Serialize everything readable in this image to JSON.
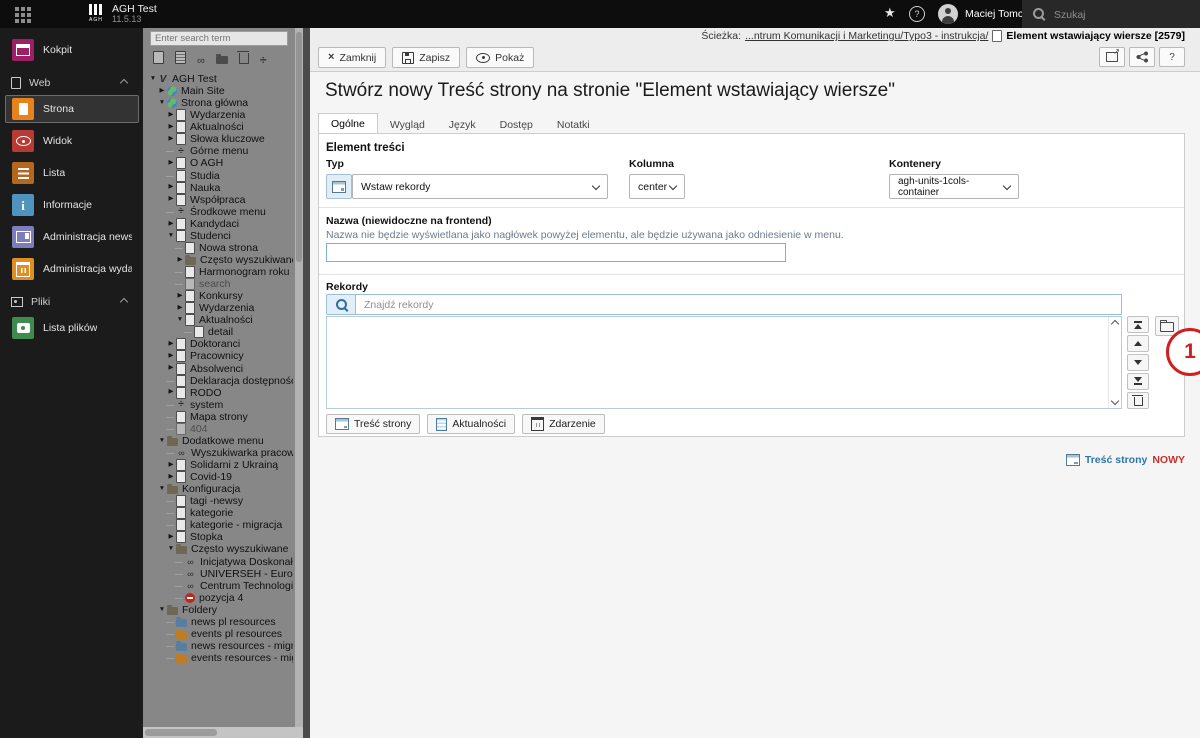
{
  "topbar": {
    "app_title": "AGH Test",
    "version": "11.5.13",
    "user_name": "Maciej Tomczyk",
    "search_placeholder": "Szukaj"
  },
  "sidebar": {
    "entries": [
      {
        "type": "module",
        "label": "Kokpit",
        "icon": "dashboard",
        "color": "#9d2064",
        "active": false
      },
      {
        "type": "header",
        "label": "Web",
        "icon": "page"
      },
      {
        "type": "module",
        "label": "Strona",
        "icon": "page",
        "color": "#e8821d",
        "active": true
      },
      {
        "type": "module",
        "label": "Widok",
        "icon": "eye",
        "color": "#b73b34",
        "active": false
      },
      {
        "type": "module",
        "label": "Lista",
        "icon": "list",
        "color": "#b4671e",
        "active": false
      },
      {
        "type": "module",
        "label": "Informacje",
        "icon": "info",
        "color": "#4f94bd",
        "active": false
      },
      {
        "type": "module",
        "label": "Administracja newsów",
        "icon": "news",
        "color": "#7d7dbb",
        "active": false
      },
      {
        "type": "module",
        "label": "Administracja wydarzeń",
        "icon": "calendar",
        "color": "#df8e22",
        "active": false
      },
      {
        "type": "header",
        "label": "Pliki",
        "icon": "image"
      },
      {
        "type": "module",
        "label": "Lista plików",
        "icon": "media",
        "color": "#3f8b4f",
        "active": false
      }
    ]
  },
  "pagetree": {
    "search_placeholder": "Enter search term",
    "toolbar": [
      {
        "name": "new-page-button",
        "glyph": "page"
      },
      {
        "name": "new-content-page-button",
        "glyph": "page2"
      },
      {
        "name": "new-link-button",
        "glyph": "link"
      },
      {
        "name": "new-folder-button",
        "glyph": "folder"
      },
      {
        "name": "trash-button",
        "glyph": "trash"
      },
      {
        "name": "new-spacer-button",
        "glyph": "spacer"
      }
    ],
    "items": [
      {
        "label": "AGH Test",
        "level": 0,
        "state": "open",
        "icon": "site"
      },
      {
        "label": "Main Site",
        "level": 1,
        "state": "closed",
        "icon": "globe"
      },
      {
        "label": "Strona główna",
        "level": 1,
        "state": "open",
        "icon": "globe"
      },
      {
        "label": "Wydarzenia",
        "level": 2,
        "state": "closed",
        "icon": "page"
      },
      {
        "label": "Aktualności",
        "level": 2,
        "state": "closed",
        "icon": "page"
      },
      {
        "label": "Słowa kluczowe",
        "level": 2,
        "state": "closed",
        "icon": "page"
      },
      {
        "label": "Górne menu",
        "level": 2,
        "state": null,
        "icon": "spacer"
      },
      {
        "label": "O AGH",
        "level": 2,
        "state": "closed",
        "icon": "page"
      },
      {
        "label": "Studia",
        "level": 2,
        "state": null,
        "icon": "page"
      },
      {
        "label": "Nauka",
        "level": 2,
        "state": "closed",
        "icon": "page"
      },
      {
        "label": "Współpraca",
        "level": 2,
        "state": "closed",
        "icon": "page"
      },
      {
        "label": "Środkowe menu",
        "level": 2,
        "state": null,
        "icon": "spacer"
      },
      {
        "label": "Kandydaci",
        "level": 2,
        "state": "closed",
        "icon": "page"
      },
      {
        "label": "Studenci",
        "level": 2,
        "state": "open",
        "icon": "page"
      },
      {
        "label": "Nowa strona",
        "level": 3,
        "state": null,
        "icon": "page"
      },
      {
        "label": "Często wyszukiwane",
        "level": 3,
        "state": "closed",
        "icon": "folder"
      },
      {
        "label": "Harmonogram roku akademi",
        "level": 3,
        "state": null,
        "icon": "page"
      },
      {
        "label": "search",
        "level": 3,
        "state": null,
        "icon": "page",
        "faded": true
      },
      {
        "label": "Konkursy",
        "level": 3,
        "state": "closed",
        "icon": "page"
      },
      {
        "label": "Wydarzenia",
        "level": 3,
        "state": "closed",
        "icon": "page"
      },
      {
        "label": "Aktualności",
        "level": 3,
        "state": "open",
        "icon": "page"
      },
      {
        "label": "detail",
        "level": 4,
        "state": null,
        "icon": "page"
      },
      {
        "label": "Doktoranci",
        "level": 2,
        "state": "closed",
        "icon": "page"
      },
      {
        "label": "Pracownicy",
        "level": 2,
        "state": "closed",
        "icon": "page"
      },
      {
        "label": "Absolwenci",
        "level": 2,
        "state": "closed",
        "icon": "page"
      },
      {
        "label": "Deklaracja dostępności",
        "level": 2,
        "state": null,
        "icon": "page"
      },
      {
        "label": "RODO",
        "level": 2,
        "state": "closed",
        "icon": "page"
      },
      {
        "label": "system",
        "level": 2,
        "state": null,
        "icon": "spacer"
      },
      {
        "label": "Mapa strony",
        "level": 2,
        "state": null,
        "icon": "page"
      },
      {
        "label": "404",
        "level": 2,
        "state": null,
        "icon": "page",
        "faded": true
      },
      {
        "label": "Dodatkowe menu",
        "level": 1,
        "state": "open",
        "icon": "folder"
      },
      {
        "label": "Wyszukiwarka pracowników",
        "level": 2,
        "state": null,
        "icon": "link"
      },
      {
        "label": "Solidarni z Ukrainą",
        "level": 2,
        "state": "closed",
        "icon": "page"
      },
      {
        "label": "Covid-19",
        "level": 2,
        "state": "closed",
        "icon": "page"
      },
      {
        "label": "Konfiguracja",
        "level": 1,
        "state": "open",
        "icon": "folder"
      },
      {
        "label": "tagi -newsy",
        "level": 2,
        "state": null,
        "icon": "page"
      },
      {
        "label": "kategorie",
        "level": 2,
        "state": null,
        "icon": "page"
      },
      {
        "label": "kategorie - migracja",
        "level": 2,
        "state": null,
        "icon": "page"
      },
      {
        "label": "Stopka",
        "level": 2,
        "state": "closed",
        "icon": "page"
      },
      {
        "label": "Często wyszukiwane",
        "level": 2,
        "state": "open",
        "icon": "folder"
      },
      {
        "label": "Inicjatywa Doskonałości –",
        "level": 3,
        "state": null,
        "icon": "link"
      },
      {
        "label": "UNIVERSEH - Europejski U",
        "level": 3,
        "state": null,
        "icon": "link"
      },
      {
        "label": "Centrum Technologii Kosm",
        "level": 3,
        "state": null,
        "icon": "link"
      },
      {
        "label": "pozycja 4",
        "level": 3,
        "state": null,
        "icon": "stop"
      },
      {
        "label": "Foldery",
        "level": 1,
        "state": "open",
        "icon": "folder"
      },
      {
        "label": "news pl resources",
        "level": 2,
        "state": null,
        "icon": "folder-news"
      },
      {
        "label": "events pl resources",
        "level": 2,
        "state": null,
        "icon": "folder-events"
      },
      {
        "label": "news resources - migrated",
        "level": 2,
        "state": null,
        "icon": "folder-news"
      },
      {
        "label": "events resources - migrated",
        "level": 2,
        "state": null,
        "icon": "folder-events"
      }
    ]
  },
  "docheader": {
    "breadcrumb_label": "Ścieżka:",
    "breadcrumb_link": "...ntrum Komunikacji i Marketingu/Typo3 - instrukcja/",
    "breadcrumb_current": "Element wstawiający wiersze [2579]",
    "buttons": [
      {
        "label": "Zamknij",
        "icon": "close"
      },
      {
        "label": "Zapisz",
        "icon": "save"
      },
      {
        "label": "Pokaż",
        "icon": "view"
      }
    ],
    "icon_buttons": [
      {
        "name": "open-in-new-window-button",
        "glyph": "ext"
      },
      {
        "name": "share-button",
        "glyph": "share"
      },
      {
        "name": "help-button",
        "glyph": "help",
        "label": "?"
      }
    ]
  },
  "form": {
    "title": "Stwórz nowy Treść strony na stronie \"Element wstawiający wiersze\"",
    "tabs": [
      {
        "label": "Ogólne",
        "active": true
      },
      {
        "label": "Wygląd",
        "active": false
      },
      {
        "label": "Język",
        "active": false
      },
      {
        "label": "Dostęp",
        "active": false
      },
      {
        "label": "Notatki",
        "active": false
      }
    ],
    "element_tresci": {
      "heading": "Element treści",
      "typ_label": "Typ",
      "typ_value": "Wstaw rekordy",
      "kolumna_label": "Kolumna",
      "kolumna_value": "center",
      "kontenery_label": "Kontenery",
      "kontenery_value": "agh-units-1cols-container"
    },
    "nazwa": {
      "label": "Nazwa (niewidoczne na frontend)",
      "description": "Nazwa nie będzie wyświetlana jako nagłówek powyżej elementu, ale będzie używana jako odniesienie w menu.",
      "value": ""
    },
    "rekordy": {
      "label": "Rekordy",
      "search_placeholder": "Znajdź rekordy",
      "move_buttons": [
        {
          "name": "move-to-top-button",
          "glyph": "top"
        },
        {
          "name": "move-up-button",
          "glyph": "up"
        },
        {
          "name": "move-down-button",
          "glyph": "down"
        },
        {
          "name": "move-to-bottom-button",
          "glyph": "bottom"
        },
        {
          "name": "remove-record-button",
          "glyph": "trash"
        }
      ],
      "add_buttons": [
        {
          "label": "Treść strony",
          "icon": "content"
        },
        {
          "label": "Aktualności",
          "icon": "news"
        },
        {
          "label": "Zdarzenie",
          "icon": "calendar"
        }
      ]
    },
    "footer_note": {
      "link": "Treść strony",
      "badge": "NOWY"
    }
  },
  "annotation": {
    "number": "1"
  }
}
